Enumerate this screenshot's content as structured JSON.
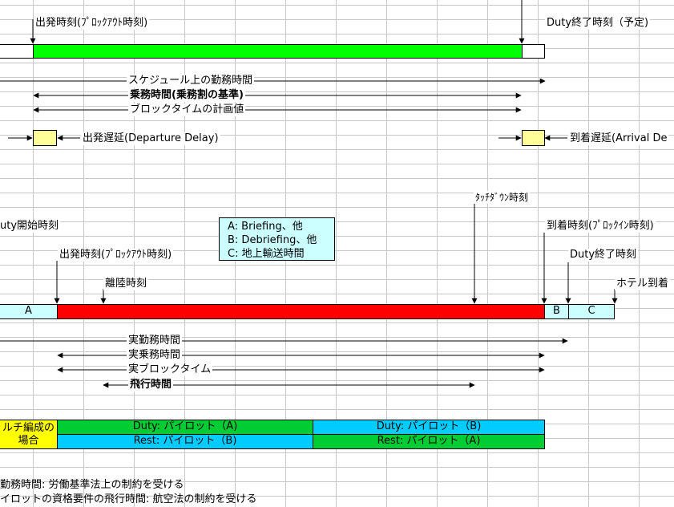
{
  "top": {
    "departure_label": "出発時刻(ﾌﾟﾛｯｸｱｳﾄ時刻)",
    "duty_end_label": "Duty終了時刻（予定)",
    "scheduled_duty_label": "スケジュール上の勤務時間",
    "crew_duty_label": "乗務時間(乗務割の基準)",
    "planned_block_label": "ブロックタイムの計画値",
    "departure_delay_label": "出発遅延(Departure Delay)",
    "arrival_delay_label": "到着遅延(Arrival De"
  },
  "actual": {
    "touchdown_label": "ﾀｯﾁﾀﾞｳﾝ時刻",
    "duty_start_label": "uty開始時刻",
    "arrival_label": "到着時刻(ﾌﾟﾛｯｸｲﾝ時刻)",
    "departure_label": "出発時刻(ﾌﾟﾛｯｸｱｳﾄ時刻)",
    "duty_end_label": "Duty終了時刻",
    "takeoff_label": "離陸時刻",
    "hotel_label": "ホテル到着",
    "segment_a": "A",
    "segment_b": "B",
    "segment_c": "C",
    "actual_duty_label": "実勤務時間",
    "actual_crew_label": "実乗務時間",
    "actual_block_label": "実ブロックタイム",
    "flight_time_label": "飛行時間"
  },
  "legend": {
    "a": "A: Briefing、他",
    "b": "B: Debriefing、他",
    "c": "C: 地上輸送時間"
  },
  "multi": {
    "label_line1": "ルチ編成の",
    "label_line2": "場合",
    "duty_a": "Duty: パイロット（A)",
    "duty_b": "Duty: パイロット（B)",
    "rest_b": "Rest: パイロット（B)",
    "rest_a": "Rest: パイロット（A)"
  },
  "notes": {
    "line1": "勤務時間: 労働基準法上の制約を受ける",
    "line2": "イロットの資格要件の飛行時間: 航空法の制約を受ける"
  },
  "colors": {
    "scheduled_bar": "#00ff00",
    "actual_bar": "#ff0000",
    "delay_box": "#ffff99",
    "segment_cells": "#ccffff",
    "legend_box": "#ccffff",
    "multi_label": "#ffff00",
    "duty_green": "#00cc33",
    "rest_cyan": "#00ccff"
  }
}
